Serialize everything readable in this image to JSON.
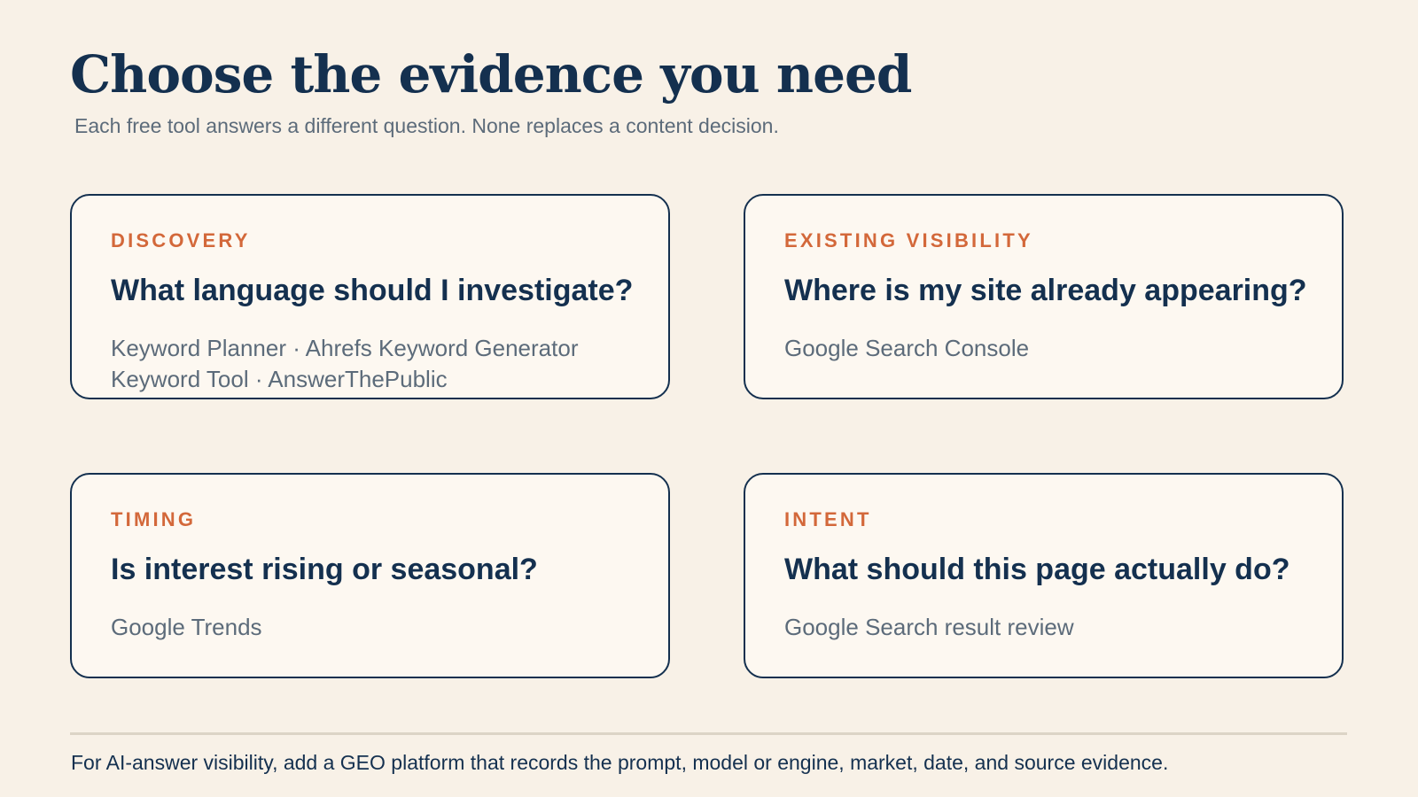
{
  "header": {
    "title": "Choose the evidence you need",
    "subtitle": "Each free tool answers a different question. None replaces a content decision."
  },
  "cards": [
    {
      "category": "DISCOVERY",
      "question": "What language should I investigate?",
      "tools": [
        "Keyword Planner · Ahrefs Keyword Generator",
        "Keyword Tool · AnswerThePublic"
      ]
    },
    {
      "category": "EXISTING VISIBILITY",
      "question": "Where is my site already appearing?",
      "tools": [
        "Google Search Console"
      ]
    },
    {
      "category": "TIMING",
      "question": "Is interest rising or seasonal?",
      "tools": [
        "Google Trends"
      ]
    },
    {
      "category": "INTENT",
      "question": "What should this page actually do?",
      "tools": [
        "Google Search result review"
      ]
    }
  ],
  "footer": {
    "note": "For AI-answer visibility, add a GEO platform that records the prompt, model or engine, market, date, and source evidence."
  },
  "colors": {
    "background": "#f8f1e7",
    "card_background": "#fdf8f1",
    "navy": "#14304f",
    "accent_orange": "#d3683a",
    "muted_text": "#5c6b7a",
    "divider": "#dcd4c6"
  }
}
